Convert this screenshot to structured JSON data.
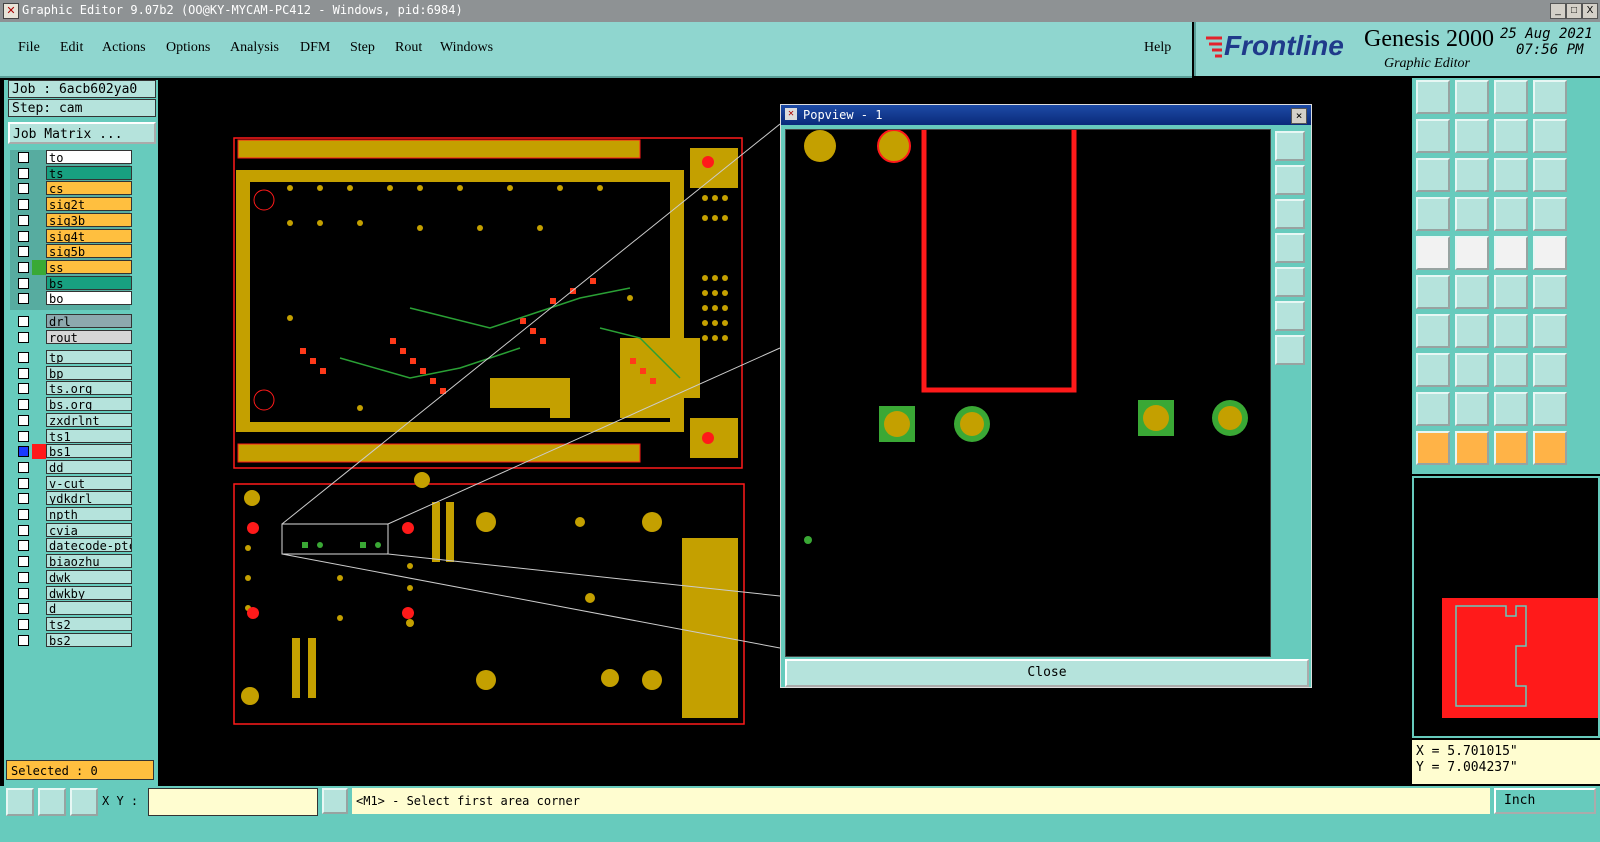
{
  "window": {
    "title": "Graphic Editor 9.07b2 (OO@KY-MYCAM-PC412 - Windows, pid:6984)",
    "min": "_",
    "max": "□",
    "close": "X"
  },
  "menu": {
    "items": [
      "File",
      "Edit",
      "Actions",
      "Options",
      "Analysis",
      "DFM",
      "Step",
      "Rout",
      "Windows"
    ],
    "help": "Help"
  },
  "brand": {
    "logo": "Frontline",
    "product": "Genesis 2000",
    "subtitle": "Graphic Editor",
    "date": "25 Aug 2021",
    "time": "07:56 PM"
  },
  "job": {
    "job": "Job : 6acb602ya0",
    "step": "Step: cam",
    "matrix": "Job Matrix ..."
  },
  "layers_group1": [
    {
      "name": "to",
      "color": "#ffffff"
    },
    {
      "name": "ts",
      "color": "#18a080"
    },
    {
      "name": "cs",
      "color": "#ffbf3f"
    },
    {
      "name": "sig2t",
      "color": "#ffbf3f"
    },
    {
      "name": "sig3b",
      "color": "#ffbf3f"
    },
    {
      "name": "sig4t",
      "color": "#ffbf3f"
    },
    {
      "name": "sig5b",
      "color": "#ffbf3f"
    },
    {
      "name": "ss",
      "color": "#ffbf3f"
    },
    {
      "name": "bs",
      "color": "#18a080"
    },
    {
      "name": "bo",
      "color": "#ffffff"
    }
  ],
  "layers_group2": [
    {
      "name": "drl",
      "color": "#8da8ae"
    },
    {
      "name": "rout",
      "color": "#d6d6d6"
    }
  ],
  "layers_group3": [
    {
      "name": "tp"
    },
    {
      "name": "bp"
    },
    {
      "name": "ts.org"
    },
    {
      "name": "bs.org"
    },
    {
      "name": "zxdrlnt"
    },
    {
      "name": "ts1"
    },
    {
      "name": "bs1"
    },
    {
      "name": "dd"
    },
    {
      "name": "v-cut"
    },
    {
      "name": "ydkdrl"
    },
    {
      "name": "npth"
    },
    {
      "name": "cvia"
    },
    {
      "name": "datecode-ptc"
    },
    {
      "name": "biaozhu"
    },
    {
      "name": "dwk"
    },
    {
      "name": "dwkby"
    },
    {
      "name": "d"
    },
    {
      "name": "ts2"
    },
    {
      "name": "bs2"
    }
  ],
  "selected": "Selected : 0",
  "popview": {
    "title": "Popview - 1",
    "close": "Close"
  },
  "coords": {
    "x": "X = 5.701015\"",
    "y": "Y = 7.004237\""
  },
  "bottom": {
    "xy_label": "X Y :",
    "xy_value": "",
    "prompt": "<M1> - Select first area corner",
    "units": "Inch"
  },
  "colors": {
    "board_gold": "#c4a000",
    "pad_red": "#ff1a1a",
    "pad_green": "#3aa835",
    "ui_teal": "#67cbbd"
  }
}
